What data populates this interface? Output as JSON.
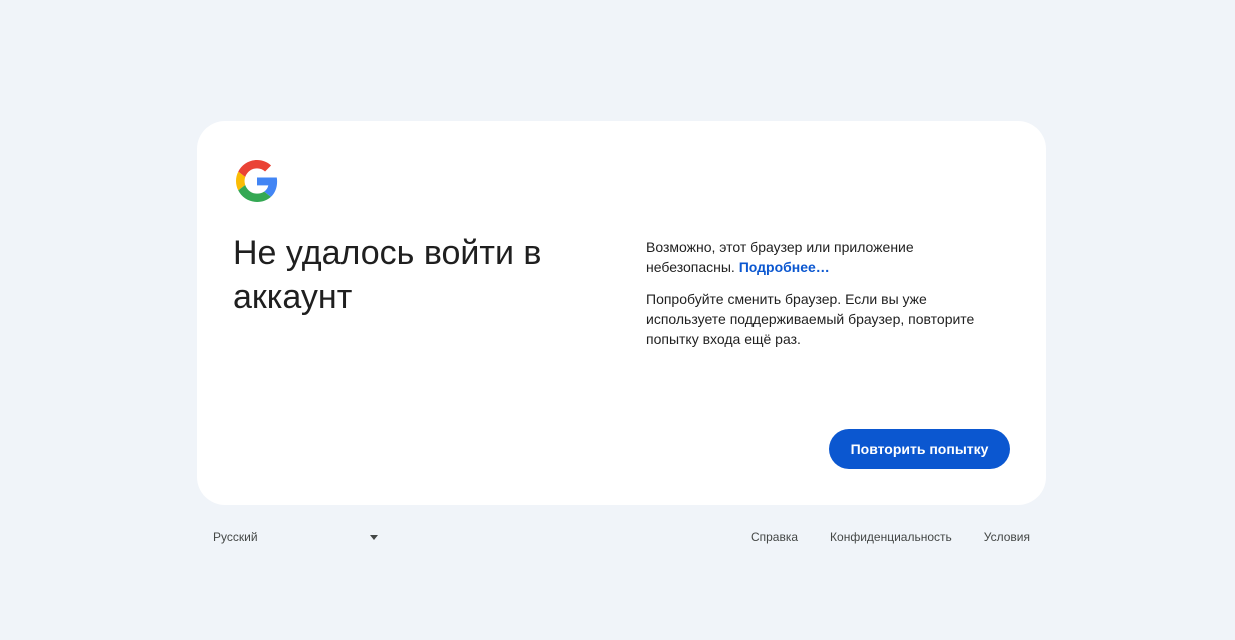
{
  "logo": {
    "icon": "google-g-icon",
    "colors": {
      "red": "#ea4335",
      "yellow": "#fbbc05",
      "green": "#34a853",
      "blue": "#4285f4"
    }
  },
  "card": {
    "title": "Не удалось войти в аккаунт",
    "paragraph1_text": "Возможно, этот браузер или приложение небезопасны. ",
    "paragraph1_link": "Подробнее…",
    "paragraph2_text": "Попробуйте сменить браузер. Если вы уже используете поддерживаемый браузер, повторите попытку входа ещё раз.",
    "retry_button": "Повторить попытку"
  },
  "footer": {
    "language": "Русский",
    "links": [
      "Справка",
      "Конфиденциальность",
      "Условия"
    ]
  },
  "colors": {
    "background": "#f0f4f9",
    "card": "#ffffff",
    "accent": "#0b57d0"
  }
}
